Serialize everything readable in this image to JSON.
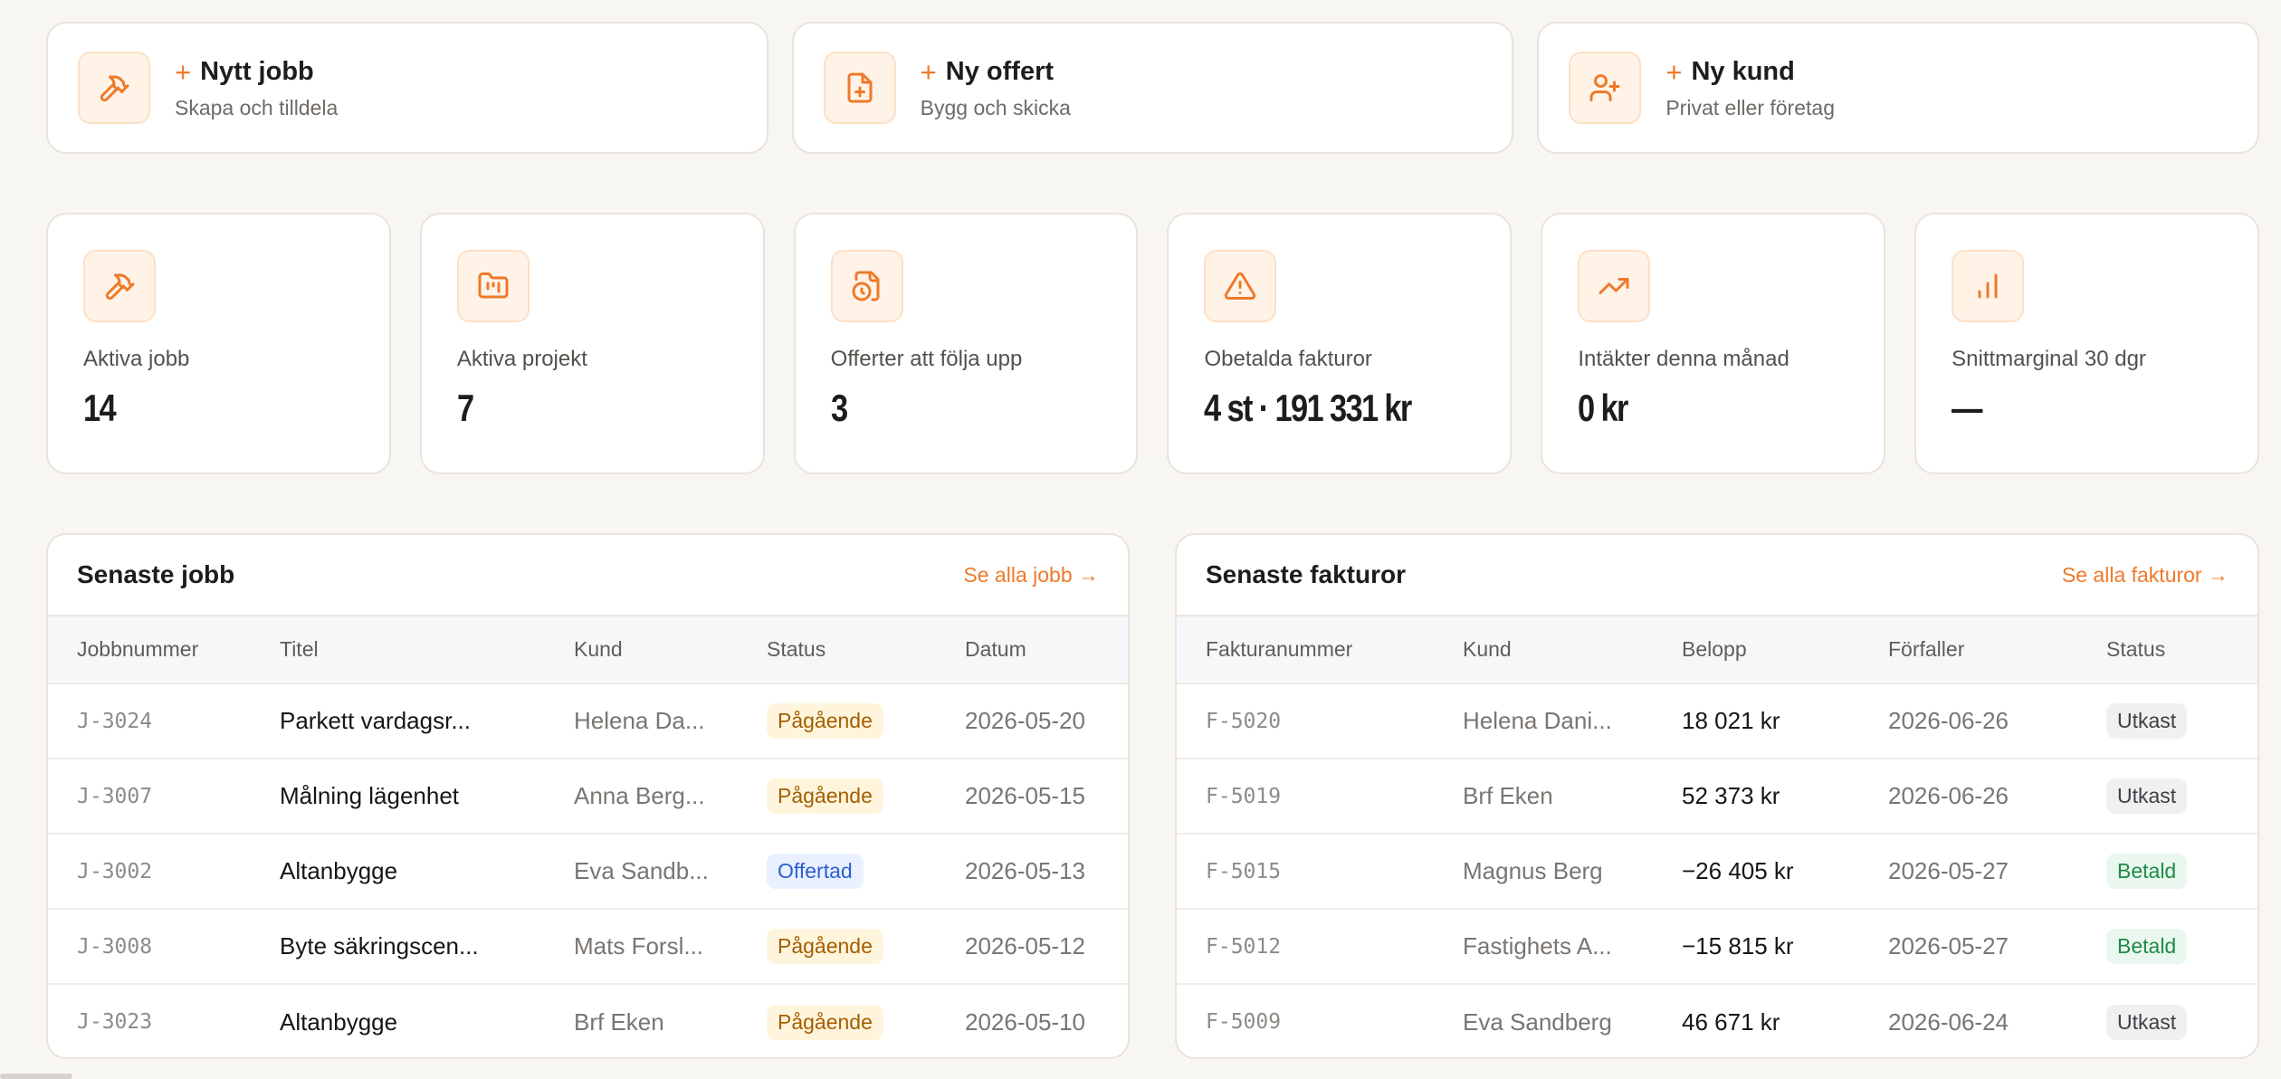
{
  "quick_actions": [
    {
      "icon": "hammer-icon",
      "title": "Nytt jobb",
      "subtitle": "Skapa och tilldela"
    },
    {
      "icon": "file-plus-icon",
      "title": "Ny offert",
      "subtitle": "Bygg och skicka"
    },
    {
      "icon": "user-plus-icon",
      "title": "Ny kund",
      "subtitle": "Privat eller företag"
    }
  ],
  "plus_symbol": "+",
  "stats": [
    {
      "icon": "hammer-icon",
      "label": "Aktiva jobb",
      "value": "14"
    },
    {
      "icon": "folder-chart-icon",
      "label": "Aktiva projekt",
      "value": "7"
    },
    {
      "icon": "file-clock-icon",
      "label": "Offerter att följa upp",
      "value": "3"
    },
    {
      "icon": "alert-triangle-icon",
      "label": "Obetalda fakturor",
      "value": "4 st · 191 331 kr"
    },
    {
      "icon": "trending-up-icon",
      "label": "Intäkter denna månad",
      "value": "0 kr"
    },
    {
      "icon": "bar-chart-icon",
      "label": "Snittmarginal 30 dgr",
      "value": "—"
    }
  ],
  "jobs": {
    "title": "Senaste jobb",
    "link": "Se alla jobb →",
    "columns": [
      "Jobbnummer",
      "Titel",
      "Kund",
      "Status",
      "Datum"
    ],
    "rows": [
      {
        "id": "J-3024",
        "title": "Parkett vardagsr...",
        "customer": "Helena Da...",
        "status": "Pågående",
        "status_kind": "pagaende",
        "date": "2026-05-20"
      },
      {
        "id": "J-3007",
        "title": "Målning lägenhet",
        "customer": "Anna Berg...",
        "status": "Pågående",
        "status_kind": "pagaende",
        "date": "2026-05-15"
      },
      {
        "id": "J-3002",
        "title": "Altanbygge",
        "customer": "Eva Sandb...",
        "status": "Offertad",
        "status_kind": "offertad",
        "date": "2026-05-13"
      },
      {
        "id": "J-3008",
        "title": "Byte säkringscen...",
        "customer": "Mats Forsl...",
        "status": "Pågående",
        "status_kind": "pagaende",
        "date": "2026-05-12"
      },
      {
        "id": "J-3023",
        "title": "Altanbygge",
        "customer": "Brf Eken",
        "status": "Pågående",
        "status_kind": "pagaende",
        "date": "2026-05-10"
      }
    ]
  },
  "invoices": {
    "title": "Senaste fakturor",
    "link": "Se alla fakturor →",
    "columns": [
      "Fakturanummer",
      "Kund",
      "Belopp",
      "Förfaller",
      "Status"
    ],
    "rows": [
      {
        "id": "F-5020",
        "customer": "Helena Dani...",
        "amount": "18 021 kr",
        "due": "2026-06-26",
        "status": "Utkast",
        "status_kind": "utkast"
      },
      {
        "id": "F-5019",
        "customer": "Brf Eken",
        "amount": "52 373 kr",
        "due": "2026-06-26",
        "status": "Utkast",
        "status_kind": "utkast"
      },
      {
        "id": "F-5015",
        "customer": "Magnus Berg",
        "amount": "−26 405 kr",
        "due": "2026-05-27",
        "status": "Betald",
        "status_kind": "betald"
      },
      {
        "id": "F-5012",
        "customer": "Fastighets A...",
        "amount": "−15 815 kr",
        "due": "2026-05-27",
        "status": "Betald",
        "status_kind": "betald"
      },
      {
        "id": "F-5009",
        "customer": "Eva Sandberg",
        "amount": "46 671 kr",
        "due": "2026-06-24",
        "status": "Utkast",
        "status_kind": "utkast"
      }
    ]
  },
  "colors": {
    "accent": "#ee7a2a",
    "background": "#f8f6f3"
  }
}
